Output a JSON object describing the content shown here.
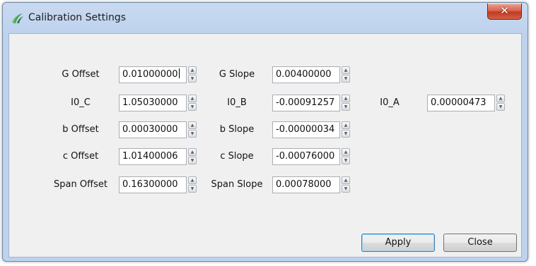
{
  "window": {
    "title": "Calibration Settings",
    "close_glyph": "✕"
  },
  "icons": {
    "app": "app-logo-icon",
    "close": "close-icon"
  },
  "fields": {
    "g_offset": {
      "label": "G Offset",
      "value": "0.01000000"
    },
    "g_slope": {
      "label": "G Slope",
      "value": "0.00400000"
    },
    "i0_c": {
      "label": "I0_C",
      "value": "1.05030000"
    },
    "i0_b": {
      "label": "I0_B",
      "value": "-0.00091257"
    },
    "i0_a": {
      "label": "I0_A",
      "value": "0.00000473"
    },
    "b_offset": {
      "label": "b Offset",
      "value": "0.00030000"
    },
    "b_slope": {
      "label": "b Slope",
      "value": "-0.00000034"
    },
    "c_offset": {
      "label": "c Offset",
      "value": "1.01400006"
    },
    "c_slope": {
      "label": "c Slope",
      "value": "-0.00076000"
    },
    "span_offset": {
      "label": "Span Offset",
      "value": "0.16300000"
    },
    "span_slope": {
      "label": "Span Slope",
      "value": "0.00078000"
    }
  },
  "spin_glyphs": {
    "up": "▲",
    "down": "▼"
  },
  "buttons": {
    "apply": "Apply",
    "close": "Close"
  },
  "colors": {
    "title_bar": "#c9daf1",
    "close_button": "#c13b24",
    "client_bg": "#f0f0f0"
  }
}
